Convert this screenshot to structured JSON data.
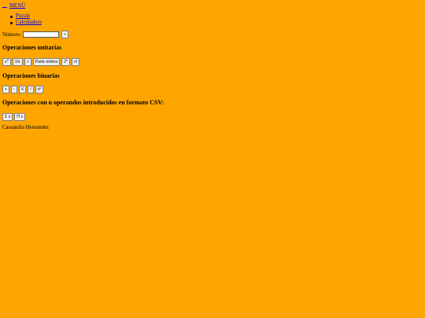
{
  "menu": {
    "label": "MENÚ"
  },
  "nav": {
    "items": [
      "Puzzle",
      "Calculadora"
    ]
  },
  "numero": {
    "label": "Número:",
    "value": "",
    "submit_label": "»"
  },
  "unary": {
    "title": "Operaciones unitarias",
    "buttons": [
      {
        "base": "x",
        "sup": "2"
      },
      {
        "base": "1/x",
        "sup": ""
      },
      {
        "base": "√",
        "sup": ""
      },
      {
        "base": "Parte entera",
        "sup": ""
      },
      {
        "base": "2",
        "sup": "n"
      },
      {
        "base": "n!",
        "sup": ""
      }
    ]
  },
  "binary": {
    "title": "Operaciones binarias",
    "buttons": [
      {
        "base": "+",
        "sup": ""
      },
      {
        "base": "-",
        "sup": ""
      },
      {
        "base": "X",
        "sup": ""
      },
      {
        "base": "/",
        "sup": ""
      },
      {
        "base": "x",
        "sup": "y"
      }
    ]
  },
  "nary": {
    "title": "Operaciones con n operandos introducidos en formato CSV:",
    "buttons": [
      "Σ x",
      "Π x"
    ]
  },
  "footer": {
    "author": "Cassandra Hernandez"
  },
  "colors": {
    "background": "#FFA500",
    "link": "#0000EE"
  }
}
